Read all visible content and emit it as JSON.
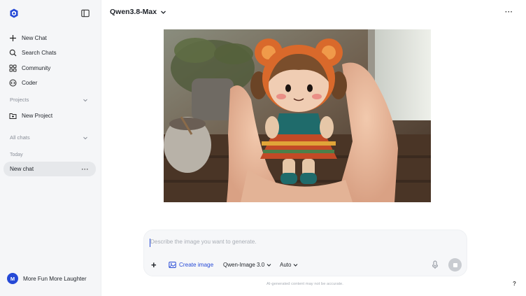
{
  "sidebar": {
    "nav": [
      {
        "label": "New Chat",
        "icon": "plus-icon"
      },
      {
        "label": "Search Chats",
        "icon": "search-icon"
      },
      {
        "label": "Community",
        "icon": "grid-icon"
      },
      {
        "label": "Coder",
        "icon": "code-icon"
      }
    ],
    "projects_title": "Projects",
    "new_project": "New Project",
    "all_chats_title": "All chats",
    "today_label": "Today",
    "chat_item": "New chat",
    "chat_item_menu": "···",
    "user": {
      "initial": "M",
      "name": "More Fun More Laughter"
    }
  },
  "header": {
    "model": "Qwen3.8-Max",
    "more": "···"
  },
  "image": {
    "subject": "crochet doll held in hands"
  },
  "composer": {
    "placeholder": "Describe the image you want to generate.",
    "plus": "+",
    "create_image": "Create image",
    "model_option": "Qwen-Image 3.0",
    "ratio_option": "Auto"
  },
  "footer": {
    "disclaimer": "AI-generated content may not be accurate.",
    "help": "?"
  },
  "colors": {
    "accent": "#2549d6",
    "sidebar_bg": "#f5f6f8",
    "selected_bg": "#e6e8eb"
  }
}
